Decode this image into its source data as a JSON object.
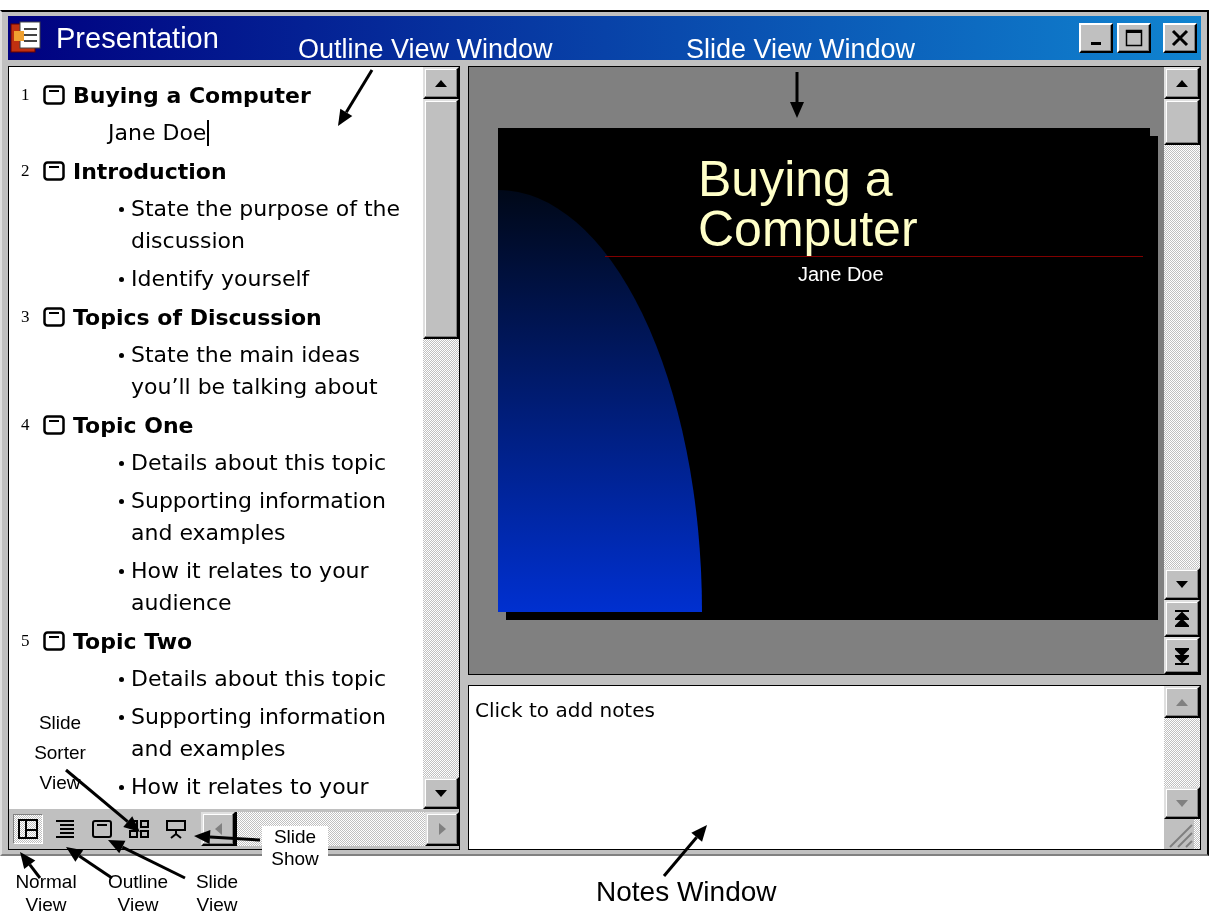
{
  "window": {
    "title": "Presentation"
  },
  "outline": {
    "slides": [
      {
        "number": "1",
        "title": "Buying a Computer",
        "items": [
          {
            "kind": "subtitle",
            "text": "Jane Doe",
            "cursor": true
          }
        ]
      },
      {
        "number": "2",
        "title": "Introduction",
        "items": [
          {
            "kind": "bullet",
            "text": "State the purpose of the discussion",
            "cursor": false
          },
          {
            "kind": "bullet",
            "text": "Identify yourself",
            "cursor": false
          }
        ]
      },
      {
        "number": "3",
        "title": "Topics of Discussion",
        "items": [
          {
            "kind": "bullet",
            "text": "State the main ideas you’ll be talking about",
            "cursor": false
          }
        ]
      },
      {
        "number": "4",
        "title": "Topic One",
        "items": [
          {
            "kind": "bullet",
            "text": "Details about this topic",
            "cursor": false
          },
          {
            "kind": "bullet",
            "text": "Supporting information and examples",
            "cursor": false
          },
          {
            "kind": "bullet",
            "text": "How it relates to your audience",
            "cursor": false
          }
        ]
      },
      {
        "number": "5",
        "title": "Topic Two",
        "items": [
          {
            "kind": "bullet",
            "text": "Details about this topic",
            "cursor": false
          },
          {
            "kind": "bullet",
            "text": "Supporting information and examples",
            "cursor": false
          },
          {
            "kind": "bullet",
            "text": "How it relates to your",
            "cursor": false
          }
        ]
      }
    ]
  },
  "view_buttons": [
    {
      "kind": "normal",
      "selected": true
    },
    {
      "kind": "outline",
      "selected": false
    },
    {
      "kind": "slide",
      "selected": false
    },
    {
      "kind": "sorter",
      "selected": false
    },
    {
      "kind": "show",
      "selected": false
    }
  ],
  "slide": {
    "title": "Buying a Computer",
    "subtitle": "Jane Doe"
  },
  "notes": {
    "placeholder": "Click to add notes"
  },
  "annotations": [
    {
      "text": "Outline View Window"
    },
    {
      "text": "Slide View Window"
    },
    {
      "text": "Notes Window"
    },
    {
      "text": "Slide Sorter View"
    },
    {
      "text": "Normal View"
    },
    {
      "text": "Outline View"
    },
    {
      "text": "Slide View"
    },
    {
      "text": "Slide Show"
    }
  ]
}
